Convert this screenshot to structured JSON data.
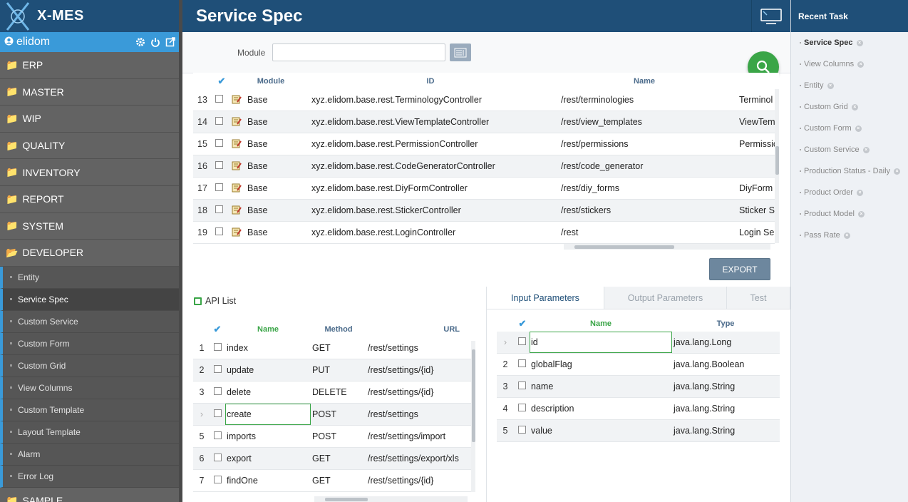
{
  "app": {
    "name": "X-MES",
    "user": "elidom",
    "page_title": "Service Spec"
  },
  "colors": {
    "header": "#1f4f78",
    "accent": "#3a9ad9",
    "green": "#3aa547",
    "sidebar": "#5f5f5f"
  },
  "sidebar": {
    "menus": [
      "ERP",
      "MASTER",
      "WIP",
      "QUALITY",
      "INVENTORY",
      "REPORT",
      "SYSTEM",
      "DEVELOPER"
    ],
    "developer_items": [
      "Entity",
      "Service Spec",
      "Custom Service",
      "Custom Form",
      "Custom Grid",
      "View Columns",
      "Custom Template",
      "Layout Template",
      "Alarm",
      "Error Log"
    ],
    "last_menu": "SAMPLE",
    "icons": [
      "gear-icon",
      "power-icon",
      "external-link-icon"
    ]
  },
  "search": {
    "module_label": "Module",
    "module_value": ""
  },
  "service_grid": {
    "headers": [
      "Module",
      "ID",
      "Name"
    ],
    "rows": [
      {
        "no": "13",
        "module": "Base",
        "id": "xyz.elidom.base.rest.TerminologyController",
        "name": "/rest/terminologies",
        "desc": "Terminol"
      },
      {
        "no": "14",
        "module": "Base",
        "id": "xyz.elidom.base.rest.ViewTemplateController",
        "name": "/rest/view_templates",
        "desc": "ViewTemp"
      },
      {
        "no": "15",
        "module": "Base",
        "id": "xyz.elidom.base.rest.PermissionController",
        "name": "/rest/permissions",
        "desc": "Permissio"
      },
      {
        "no": "16",
        "module": "Base",
        "id": "xyz.elidom.base.rest.CodeGeneratorController",
        "name": "/rest/code_generator",
        "desc": ""
      },
      {
        "no": "17",
        "module": "Base",
        "id": "xyz.elidom.base.rest.DiyFormController",
        "name": "/rest/diy_forms",
        "desc": "DiyForm S"
      },
      {
        "no": "18",
        "module": "Base",
        "id": "xyz.elidom.base.rest.StickerController",
        "name": "/rest/stickers",
        "desc": "Sticker Se"
      },
      {
        "no": "19",
        "module": "Base",
        "id": "xyz.elidom.base.rest.LoginController",
        "name": "/rest",
        "desc": "Login Se"
      }
    ]
  },
  "export_label": "EXPORT",
  "api_list": {
    "title": "API List",
    "headers": [
      "Name",
      "Method",
      "URL"
    ],
    "rows": [
      {
        "no": "1",
        "name": "index",
        "method": "GET",
        "url": "/rest/settings"
      },
      {
        "no": "2",
        "name": "update",
        "method": "PUT",
        "url": "/rest/settings/{id}"
      },
      {
        "no": "3",
        "name": "delete",
        "method": "DELETE",
        "url": "/rest/settings/{id}"
      },
      {
        "no": "",
        "name": "create",
        "method": "POST",
        "url": "/rest/settings"
      },
      {
        "no": "5",
        "name": "imports",
        "method": "POST",
        "url": "/rest/settings/import"
      },
      {
        "no": "6",
        "name": "export",
        "method": "GET",
        "url": "/rest/settings/export/xls"
      },
      {
        "no": "7",
        "name": "findOne",
        "method": "GET",
        "url": "/rest/settings/{id}"
      }
    ]
  },
  "param_tabs": [
    "Input Parameters",
    "Output Parameters",
    "Test"
  ],
  "params": {
    "headers": [
      "Name",
      "Type"
    ],
    "rows": [
      {
        "no": "",
        "name": "id",
        "type": "java.lang.Long"
      },
      {
        "no": "2",
        "name": "globalFlag",
        "type": "java.lang.Boolean"
      },
      {
        "no": "3",
        "name": "name",
        "type": "java.lang.String"
      },
      {
        "no": "4",
        "name": "description",
        "type": "java.lang.String"
      },
      {
        "no": "5",
        "name": "value",
        "type": "java.lang.String"
      }
    ]
  },
  "recent": {
    "title": "Recent Task",
    "items": [
      "Service Spec",
      "View Columns",
      "Entity",
      "Custom Grid",
      "Custom Form",
      "Custom Service",
      "Production Status - Daily",
      "Product Order",
      "Product Model",
      "Pass Rate"
    ]
  }
}
